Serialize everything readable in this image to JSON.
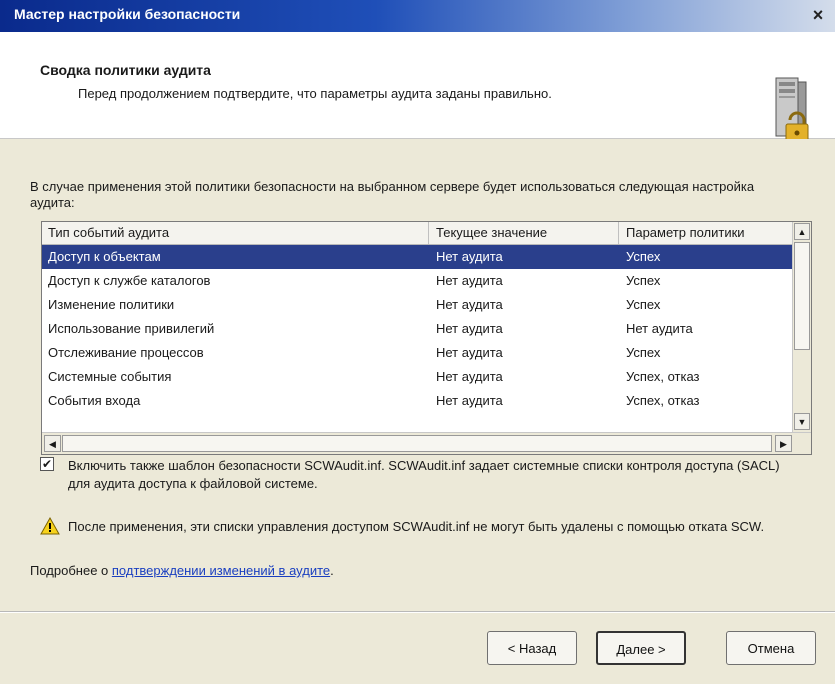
{
  "window": {
    "title": "Мастер настройки безопасности",
    "close_glyph": "×"
  },
  "header": {
    "title": "Сводка политики аудита",
    "subtitle": "Перед продолжением подтвердите, что параметры аудита заданы правильно.",
    "icon": "server-lock-icon"
  },
  "intro": "В случае применения этой политики безопасности на выбранном сервере будет использоваться следующая настройка аудита:",
  "table": {
    "columns": [
      "Тип событий аудита",
      "Текущее значение",
      "Параметр политики"
    ],
    "rows": [
      [
        "Доступ к объектам",
        "Нет аудита",
        "Успех"
      ],
      [
        "Доступ к службе каталогов",
        "Нет аудита",
        "Успех"
      ],
      [
        "Изменение политики",
        "Нет аудита",
        "Успех"
      ],
      [
        "Использование привилегий",
        "Нет аудита",
        "Нет аудита"
      ],
      [
        "Отслеживание процессов",
        "Нет аудита",
        "Успех"
      ],
      [
        "Системные события",
        "Нет аудита",
        "Успех, отказ"
      ],
      [
        "События входа",
        "Нет аудита",
        "Успех, отказ"
      ]
    ],
    "selected_row": 0
  },
  "checkbox": {
    "checked": true,
    "glyph": "✔",
    "label": "Включить также шаблон безопасности SCWAudit.inf. SCWAudit.inf задает системные списки контроля доступа (SACL) для аудита доступа к файловой системе."
  },
  "warning": {
    "icon": "warning-icon",
    "text": "После применения, эти списки управления доступом SCWAudit.inf не могут быть удалены с помощью отката SCW."
  },
  "more": {
    "prefix": "Подробнее о ",
    "link": "подтверждении изменений в аудите",
    "suffix": "."
  },
  "buttons": {
    "back": "< Назад",
    "next": "Далее >",
    "cancel": "Отмена"
  },
  "colors": {
    "selection": "#2a3f8c",
    "title_bar": "#0a2a8c",
    "dialog_bg": "#ece9d8",
    "link": "#1a3fc0"
  }
}
